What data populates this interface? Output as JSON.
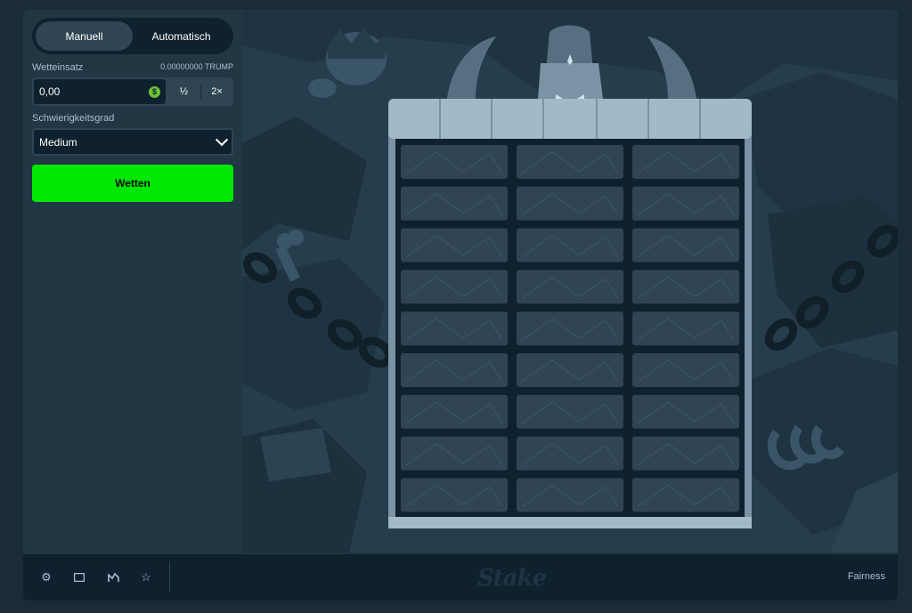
{
  "tabs": {
    "manual": "Manuell",
    "auto": "Automatisch"
  },
  "bet": {
    "label": "Wetteinsatz",
    "balance": "0.00000000 TRUMP",
    "value": "0,00",
    "currency_icon": "$",
    "half": "½",
    "double": "2×"
  },
  "difficulty": {
    "label": "Schwierigkeitsgrad",
    "value": "Medium"
  },
  "bet_button": "Wetten",
  "board": {
    "rows": 9,
    "cols": 3
  },
  "footer": {
    "icons": [
      "gear-icon",
      "window-icon",
      "stats-icon",
      "star-icon"
    ],
    "logo": "Stake",
    "fairness": "Fairness"
  },
  "colors": {
    "accent_green": "#00e701",
    "panel": "#213743",
    "background": "#0f212e"
  }
}
